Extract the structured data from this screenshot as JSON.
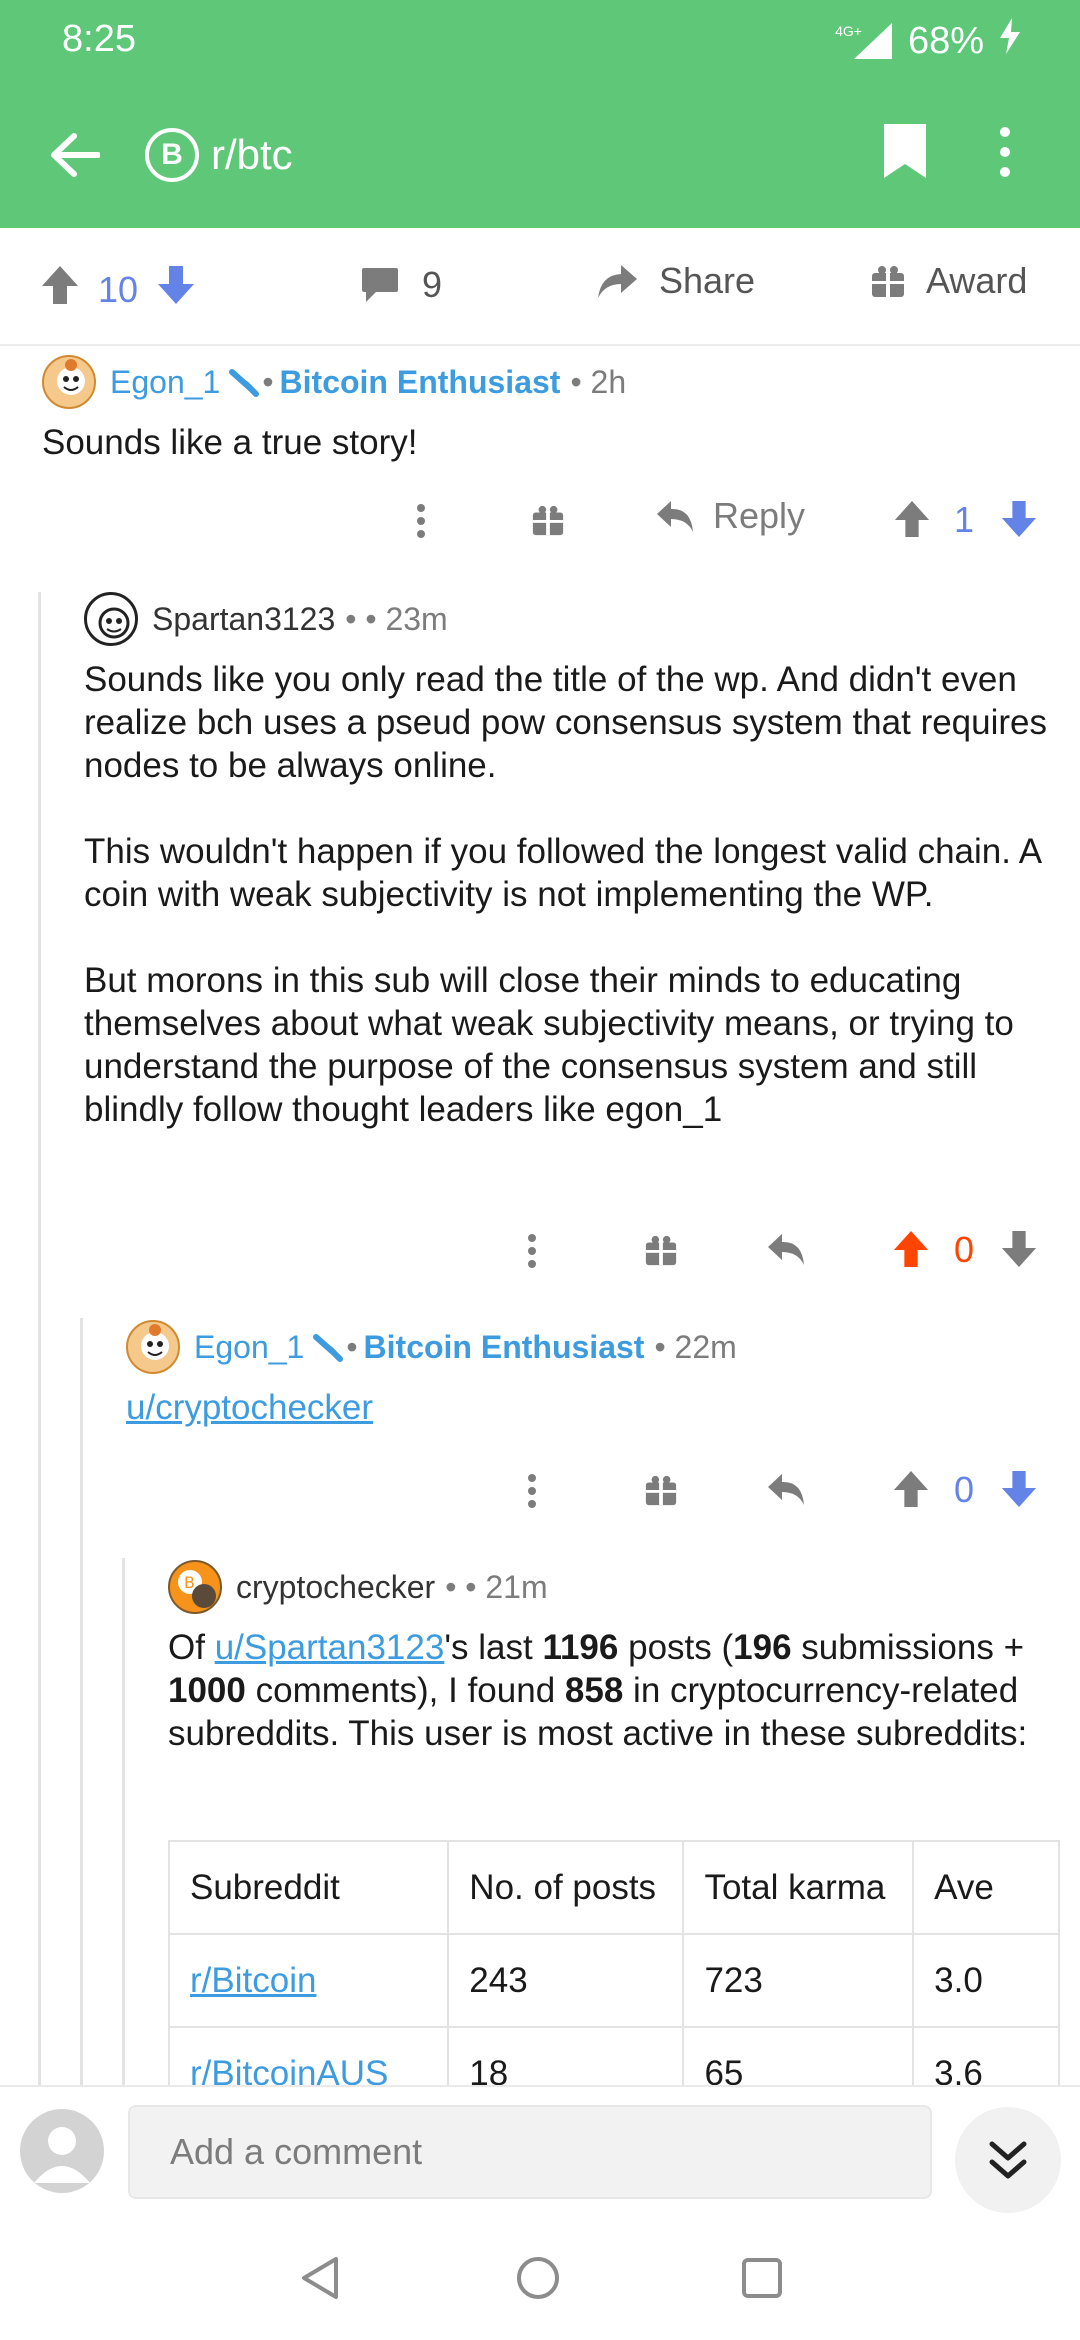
{
  "status": {
    "time": "8:25",
    "network": "4G+",
    "battery": "68%"
  },
  "toolbar": {
    "subreddit": "r/btc",
    "icon_letter": "B"
  },
  "post_actions": {
    "votes": "10",
    "comments": "9",
    "share": "Share",
    "award": "Award"
  },
  "comments": [
    {
      "author": "Egon_1",
      "flair": "Bitcoin Enthusiast",
      "meta": "• 2h",
      "body": "Sounds like a true story!",
      "reply": "Reply",
      "votes": "1"
    },
    {
      "author": "Spartan3123",
      "meta": "• • 23m",
      "paragraphs": [
        "Sounds like you only read the title of the wp. And didn't even realize bch uses a pseud pow consensus system that requires nodes to be always online.",
        "This wouldn't happen if you followed the longest valid chain. A coin with weak subjectivity is not implementing the WP.",
        "But morons in this sub will close their minds to educating themselves about what weak subjectivity means, or trying to understand the purpose of the consensus system and still blindly follow thought leaders like egon_1"
      ],
      "votes": "0"
    },
    {
      "author": "Egon_1",
      "flair": "Bitcoin Enthusiast",
      "meta": "• 22m",
      "link": "u/cryptochecker",
      "votes": "0"
    },
    {
      "author": "cryptochecker",
      "meta": "• • 21m",
      "t1": "Of ",
      "user_link": "u/Spartan3123",
      "t2": "'s last ",
      "n1": "1196",
      "t3": " posts (",
      "n2": "196",
      "t4": " submissions + ",
      "n3": "1000",
      "t5": " comments), I found ",
      "n4": "858",
      "t6": " in cryptocurrency-related subreddits. This user is most active in these subreddits:",
      "table": {
        "headers": [
          "Subreddit",
          "No. of posts",
          "Total karma",
          "Ave"
        ],
        "rows": [
          [
            "r/Bitcoin",
            "243",
            "723",
            "3.0"
          ],
          [
            "r/BitcoinAUS",
            "18",
            "65",
            "3.6"
          ]
        ]
      }
    }
  ],
  "composer": {
    "placeholder": "Add a comment"
  },
  "colors": {
    "header": "#5ec878",
    "blue": "#3d9be0",
    "upvote_active": "#ff4500",
    "downvote": "#6383e6"
  }
}
